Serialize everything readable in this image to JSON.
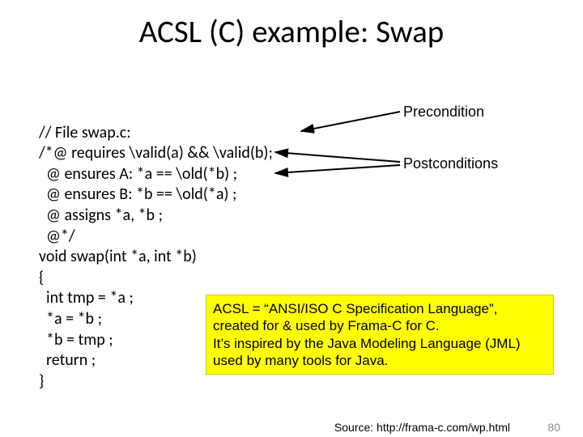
{
  "title": "ACSL (C) example: Swap",
  "code": {
    "l1": "// File swap.c:",
    "l2": "/*@ requires \\valid(a) && \\valid(b);",
    "l3": "  @ ensures A: *a == \\old(*b) ;",
    "l4": "  @ ensures B: *b == \\old(*a) ;",
    "l5": "  @ assigns *a, *b ;",
    "l6": "  @*/",
    "l7": "void swap(int *a, int *b)",
    "l8": "{",
    "l9": "  int tmp = *a ;",
    "l10": "  *a = *b ;",
    "l11": "  *b = tmp ;",
    "l12": "  return ;",
    "l13": "}"
  },
  "labels": {
    "pre": "Precondition",
    "post": "Postconditions"
  },
  "yellow": {
    "l1": "ACSL = “ANSI/ISO C Specification Language”,",
    "l2": "created for & used by Frama-C for C.",
    "l3": "It’s inspired by the Java Modeling Language (JML)",
    "l4": "used by many tools for Java."
  },
  "source": "Source: http://frama-c.com/wp.html",
  "pagenum": "80"
}
